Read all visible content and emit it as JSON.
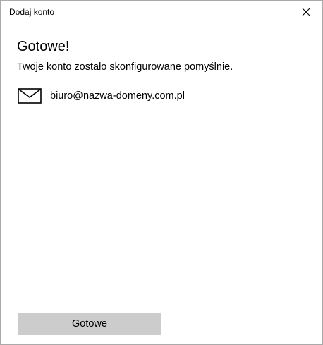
{
  "window": {
    "title": "Dodaj konto",
    "close_icon": "close-icon"
  },
  "main": {
    "heading": "Gotowe!",
    "message": "Twoje konto zostało skonfigurowane pomyślnie.",
    "account": {
      "icon": "mail-icon",
      "email": "biuro@nazwa-domeny.com.pl"
    }
  },
  "footer": {
    "done_label": "Gotowe"
  },
  "colors": {
    "button_bg": "#cccccc",
    "border": "#aaaaaa",
    "text": "#000000"
  }
}
